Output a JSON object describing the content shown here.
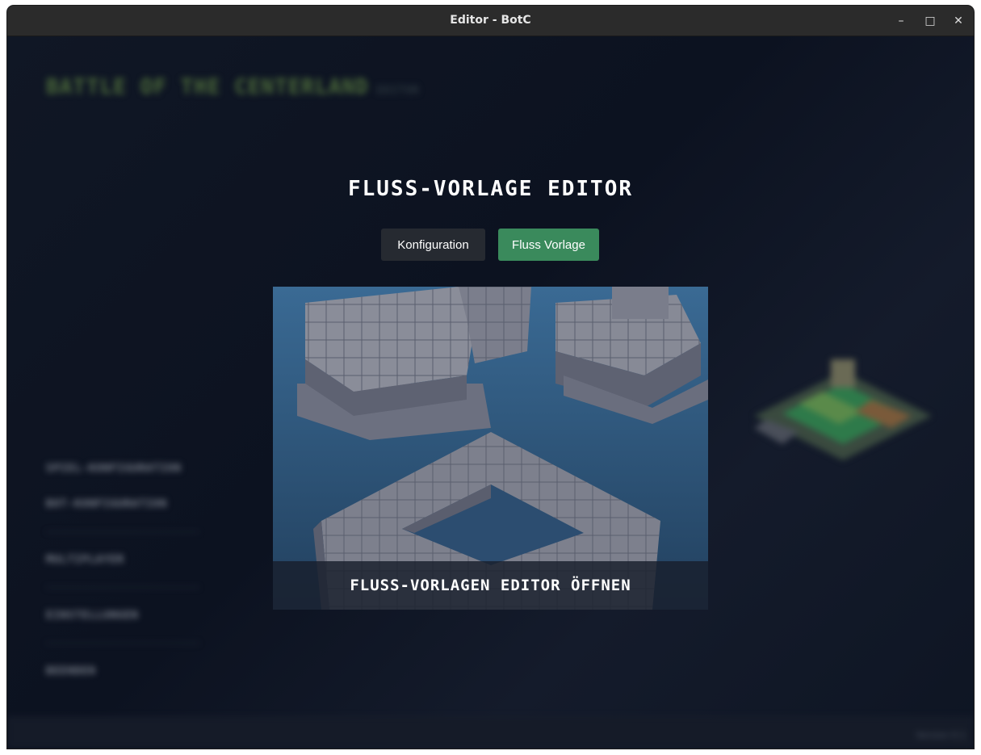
{
  "window": {
    "title": "Editor - BotC",
    "controls": {
      "minimize": "–",
      "maximize": "□",
      "close": "✕"
    }
  },
  "background": {
    "logo": "BATTLE OF THE CENTERLAND",
    "logo_sub": "EDITOR",
    "menu": [
      "SPIEL-KONFIGURATION",
      "BOT-KONFIGURATION",
      "MULTIPLAYER",
      "EINSTELLUNGEN",
      "BEENDEN"
    ],
    "footer": "Version 0.1"
  },
  "editor": {
    "title": "FLUSS-VORLAGE EDITOR",
    "tabs": [
      {
        "label": "Konfiguration",
        "active": false
      },
      {
        "label": "Fluss Vorlage",
        "active": true
      }
    ],
    "card": {
      "label": "FLUSS-VORLAGEN EDITOR ÖFFNEN"
    }
  },
  "colors": {
    "active_tab": "#3a8a5c",
    "inactive_tab": "#262a31",
    "background": "#0e1422",
    "card_water": "#2f5378"
  }
}
